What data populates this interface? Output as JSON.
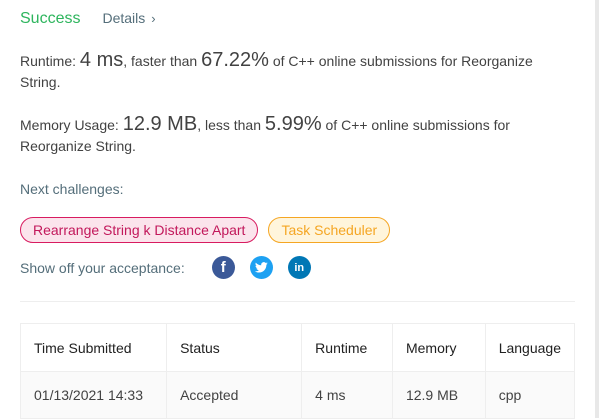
{
  "header": {
    "status": "Success",
    "details_label": "Details",
    "details_chevron": "›"
  },
  "runtime": {
    "label": "Runtime:",
    "value": "4 ms",
    "comparison": ", faster than",
    "percent": "67.22%",
    "suffix": "of C++ online submissions for Reorganize String."
  },
  "memory": {
    "label": "Memory Usage:",
    "value": "12.9 MB",
    "comparison": ", less than",
    "percent": "5.99%",
    "suffix": "of C++ online submissions for Reorganize String."
  },
  "next_challenges": {
    "label": "Next challenges:",
    "items": [
      {
        "label": "Rearrange String k Distance Apart",
        "difficulty": "hard"
      },
      {
        "label": "Task Scheduler",
        "difficulty": "medium"
      }
    ]
  },
  "share": {
    "label": "Show off your acceptance:",
    "icons": [
      "facebook-icon",
      "twitter-icon",
      "linkedin-icon"
    ],
    "glyphs": {
      "facebook": "f",
      "twitter": "🐦",
      "linkedin": "in"
    }
  },
  "colors": {
    "success": "#2db55d",
    "hard_text": "#c2185b",
    "hard_bg": "#fbe4ec",
    "medium_text": "#f5a623",
    "medium_bg": "#fff5dc",
    "facebook": "#3b5998",
    "twitter": "#1da1f2",
    "linkedin": "#0077b5"
  },
  "submissions": {
    "columns": [
      "Time Submitted",
      "Status",
      "Runtime",
      "Memory",
      "Language"
    ],
    "rows": [
      {
        "time": "01/13/2021 14:33",
        "status": "Accepted",
        "runtime": "4 ms",
        "memory": "12.9 MB",
        "language": "cpp"
      }
    ]
  }
}
